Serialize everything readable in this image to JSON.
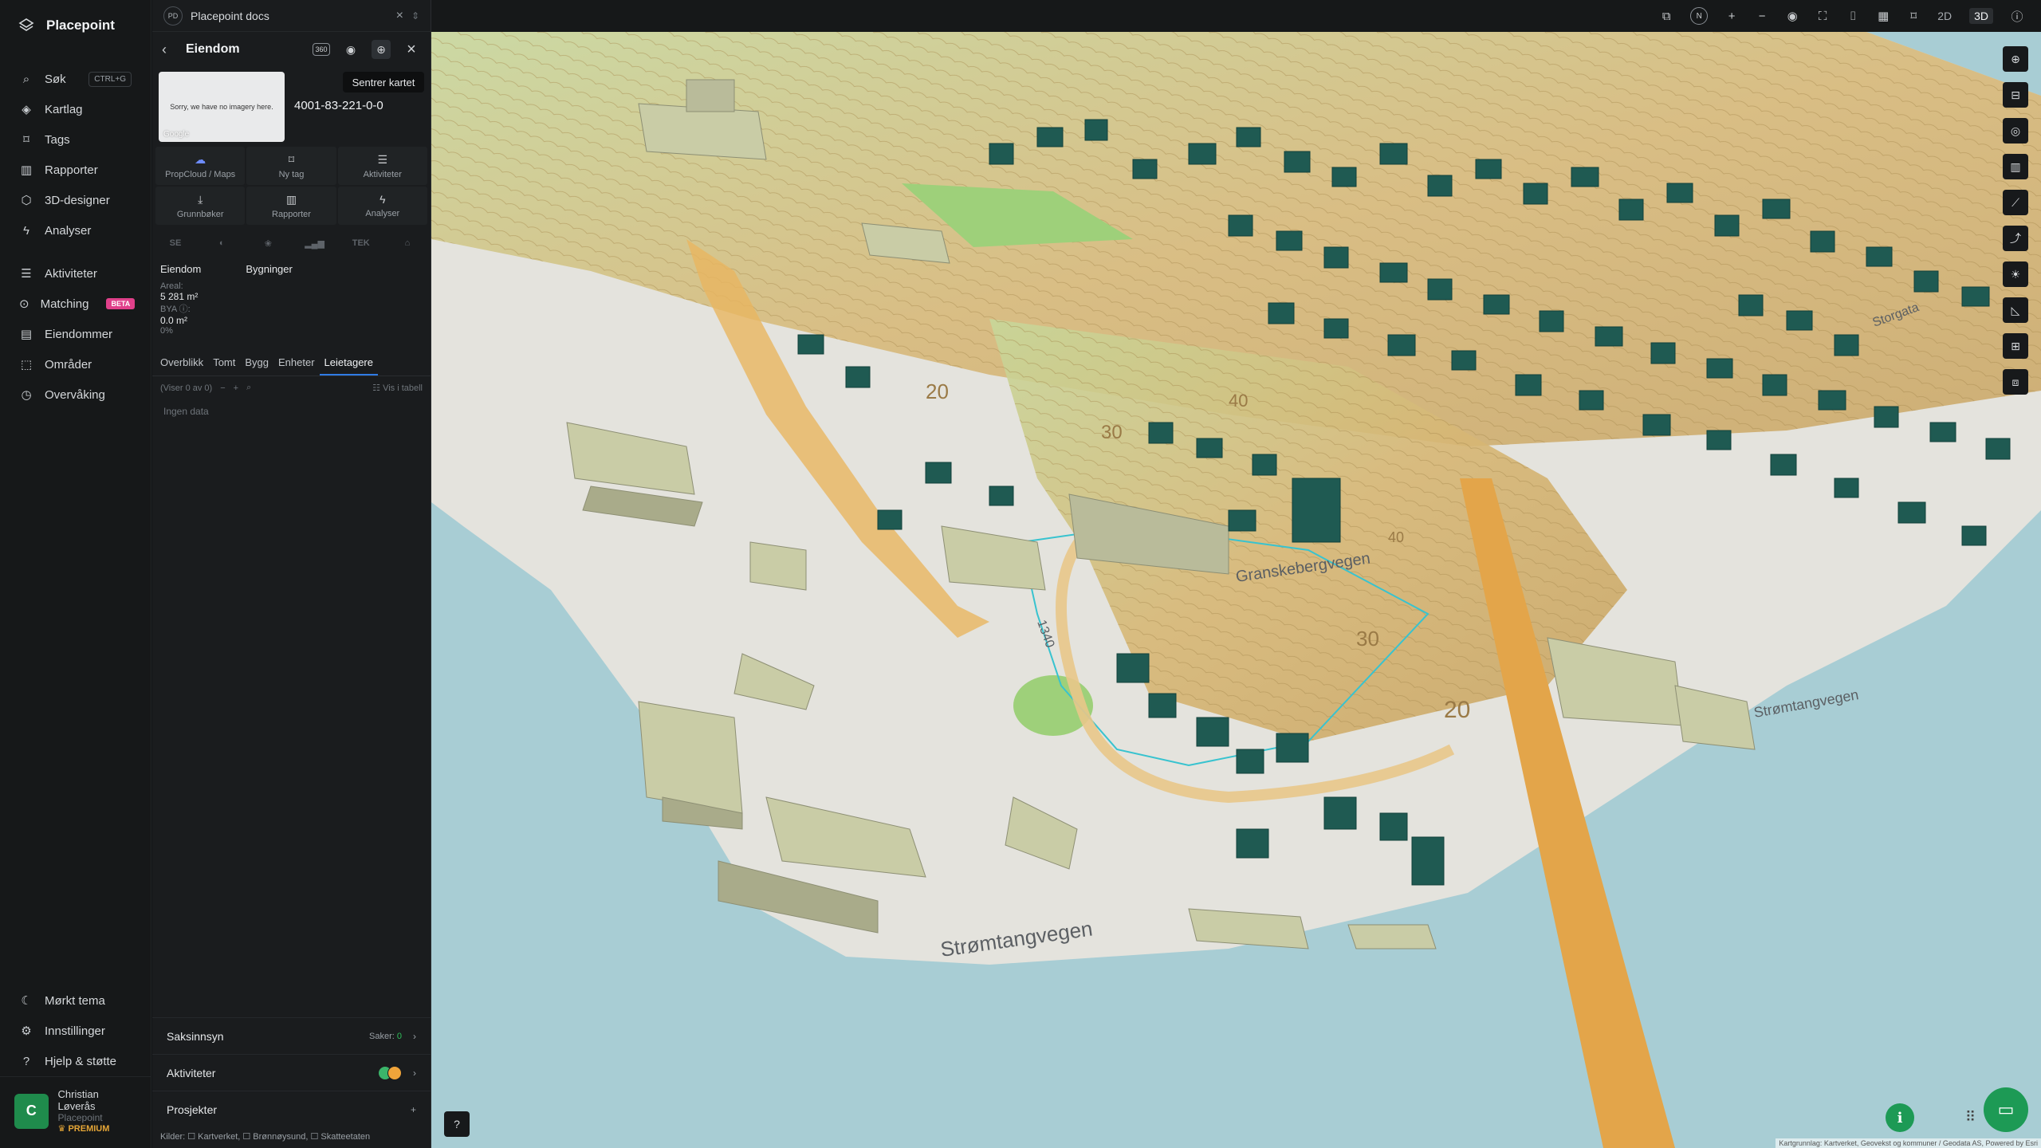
{
  "app": {
    "name": "Placepoint"
  },
  "nav": {
    "items": [
      {
        "label": "Søk",
        "icon": "search-icon",
        "shortcut": "CTRL+G"
      },
      {
        "label": "Kartlag",
        "icon": "layers-icon"
      },
      {
        "label": "Tags",
        "icon": "bookmark-icon"
      },
      {
        "label": "Rapporter",
        "icon": "bar-chart-icon"
      },
      {
        "label": "3D-designer",
        "icon": "cube-icon"
      },
      {
        "label": "Analyser",
        "icon": "bolt-icon"
      }
    ],
    "items2": [
      {
        "label": "Aktiviteter",
        "icon": "chat-icon"
      },
      {
        "label": "Matching",
        "icon": "search-doc-icon",
        "badge": "BETA"
      },
      {
        "label": "Eiendommer",
        "icon": "building-list-icon"
      },
      {
        "label": "Områder",
        "icon": "area-icon"
      },
      {
        "label": "Overvåking",
        "icon": "monitor-icon"
      }
    ],
    "bottom": [
      {
        "label": "Mørkt tema",
        "icon": "moon-icon"
      },
      {
        "label": "Innstillinger",
        "icon": "gear-icon"
      },
      {
        "label": "Hjelp & støtte",
        "icon": "help-icon"
      }
    ],
    "user": {
      "initial": "C",
      "name": "Christian Løverås",
      "org": "Placepoint",
      "plan": "PREMIUM"
    }
  },
  "panel": {
    "doc_tab": {
      "badge": "PD",
      "title": "Placepoint docs"
    },
    "title": "Eiendom",
    "tooltip": "Sentrer kartet",
    "thumb": {
      "text": "Sorry, we have no imagery here.",
      "brand": "Google"
    },
    "property_id": "4001-83-221-0-0",
    "actions": [
      {
        "label": "PropCloud / Maps",
        "icon": "propcloud-icon"
      },
      {
        "label": "Ny tag",
        "icon": "bookmark-icon"
      },
      {
        "label": "Aktiviteter",
        "icon": "chat-icon"
      },
      {
        "label": "Grunnbøker",
        "icon": "download-icon"
      },
      {
        "label": "Rapporter",
        "icon": "bar-chart-icon"
      },
      {
        "label": "Analyser",
        "icon": "bolt-icon"
      }
    ],
    "strip": [
      "SE",
      "◐",
      "❀",
      "▂▄▆",
      "TEK",
      "⌂"
    ],
    "info": {
      "head1": "Eiendom",
      "head2": "Bygninger",
      "areal_label": "Areal:",
      "areal_value": "5 281 m²",
      "bya_label": "BYA ⓘ:",
      "bya_value": "0.0 m²",
      "bya_pct": "0%"
    },
    "tabs": [
      "Overblikk",
      "Tomt",
      "Bygg",
      "Enheter",
      "Leietagere"
    ],
    "active_tab": "Leietagere",
    "list": {
      "count": "(Viser 0 av 0)",
      "table": "Vis i tabell",
      "empty": "Ingen data"
    },
    "sections": {
      "saksinnsyn": "Saksinnsyn",
      "saker_label": "Saker:",
      "saker_value": "0",
      "aktiviteter": "Aktiviteter",
      "prosjekter": "Prosjekter"
    },
    "sources": "Kilder: ☐ Kartverket, ☐ Brønnøysund, ☐ Skatteetaten"
  },
  "topbar": {
    "mode_2d": "2D",
    "mode_3d": "3D",
    "north": "N"
  },
  "map": {
    "streets": [
      "Strømtangvegen",
      "Granskebergvegen",
      "Storgata",
      "Strømtangvegen"
    ],
    "contour_labels": [
      "20",
      "30",
      "40",
      "20",
      "30",
      "40",
      "1340"
    ],
    "attribution": "Kartgrunnlag: Kartverket, Geovekst og kommuner / Geodata AS, Powered by Esri",
    "colors": {
      "water": "#a8cdd4",
      "land": "#e5e4df",
      "grass": "#b7d98c",
      "terrain": "#d9b26b",
      "house": "#1f5a52",
      "road": "#e3a54a"
    }
  }
}
